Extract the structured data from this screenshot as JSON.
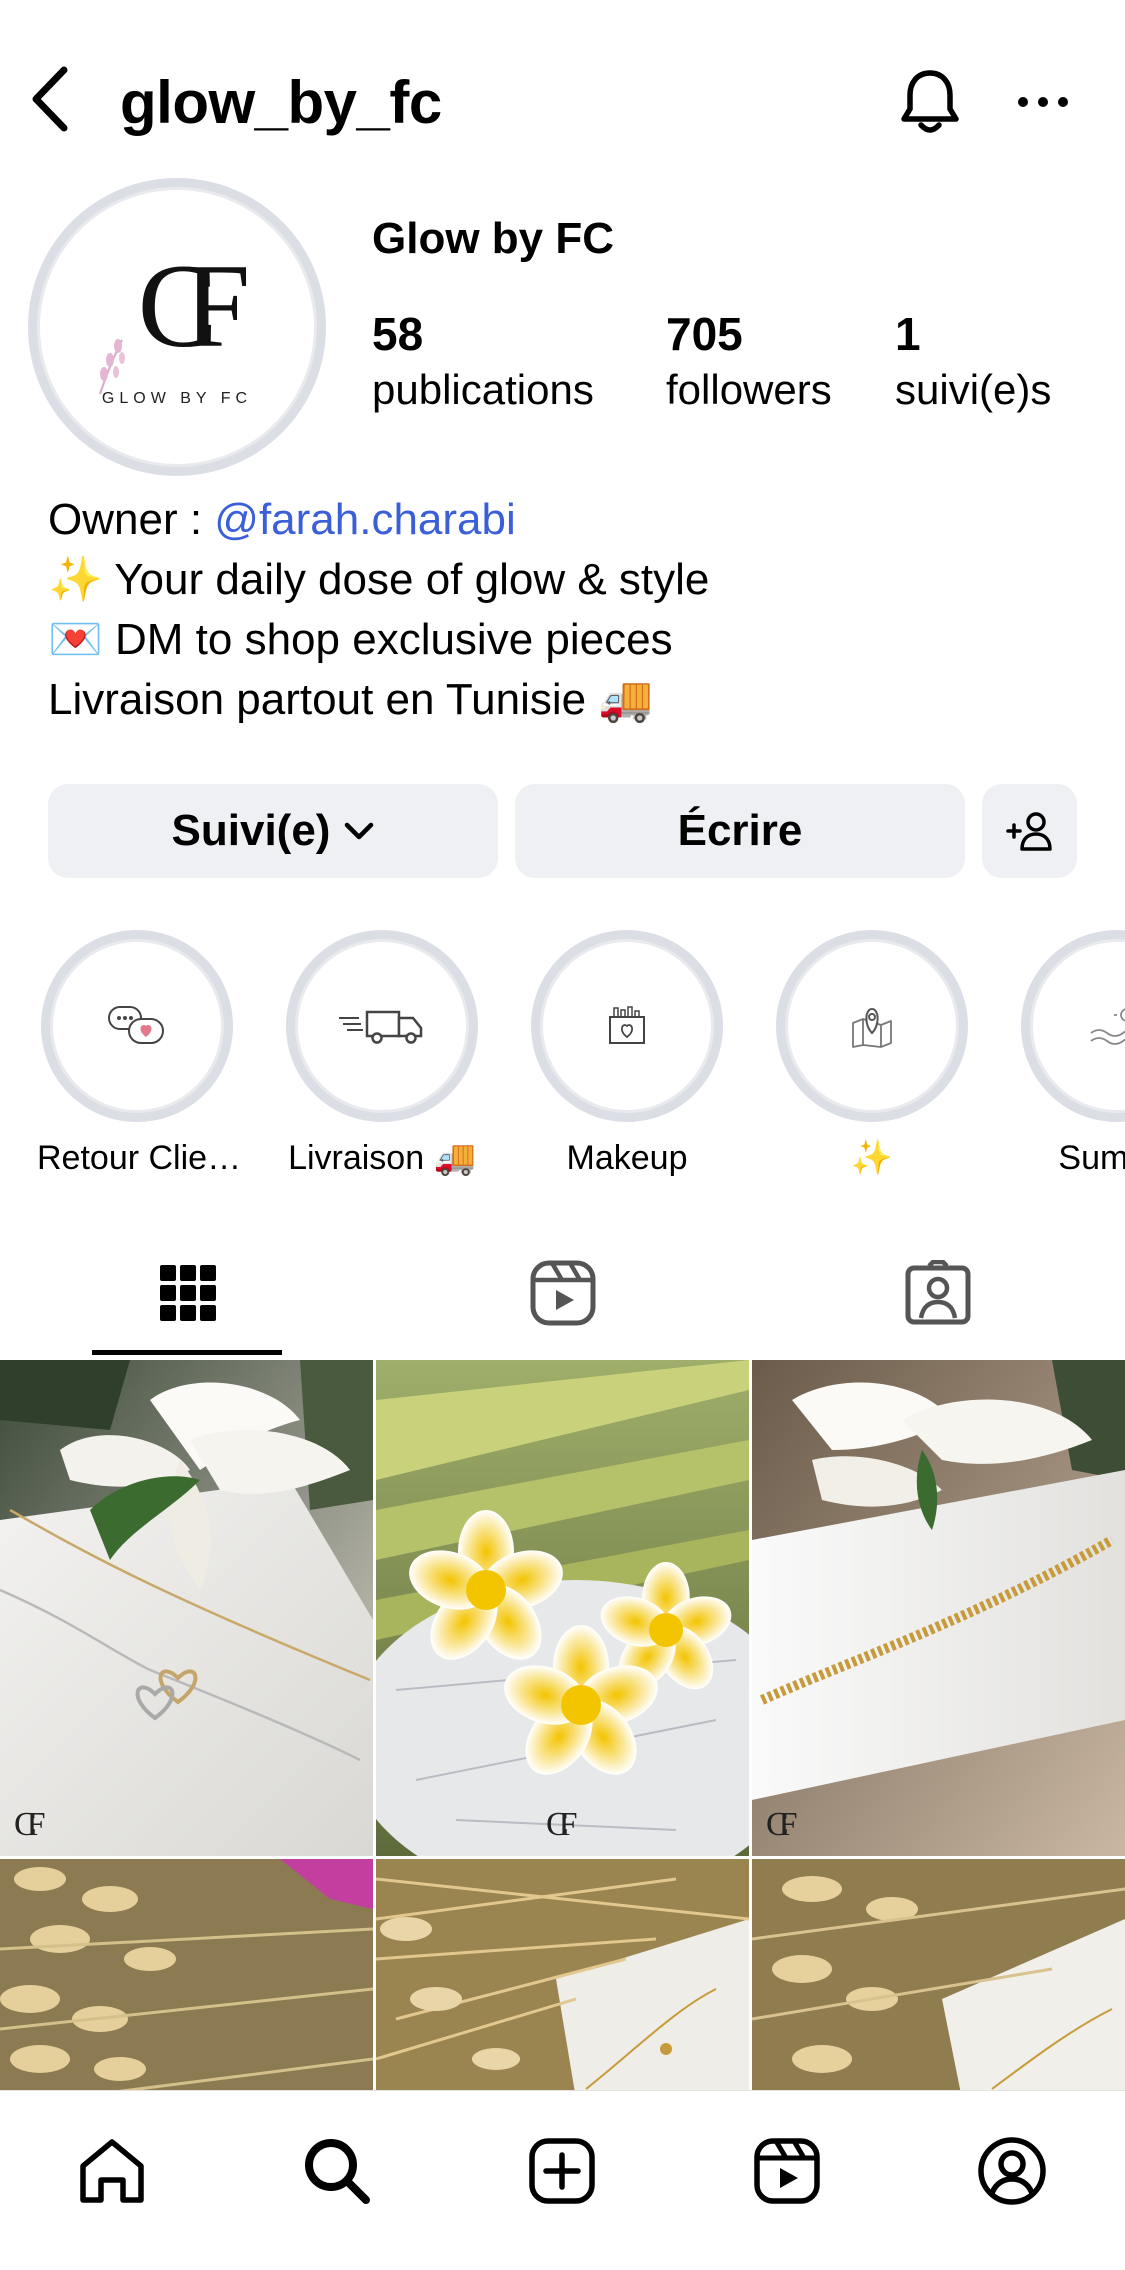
{
  "header": {
    "username": "glow_by_fc"
  },
  "profile": {
    "avatar_monogram": "CF",
    "avatar_brand": "GLOW BY FC",
    "display_name": "Glow by FC",
    "stats": {
      "posts_count": "58",
      "posts_label": "publications",
      "followers_count": "705",
      "followers_label": "followers",
      "following_count": "1",
      "following_label": "suivi(e)s"
    },
    "bio": {
      "owner_prefix": "Owner : ",
      "owner_mention": "@farah.charabi",
      "line2": "✨ Your daily dose of glow & style",
      "line3": "💌 DM to shop exclusive pieces",
      "line4": "Livraison partout en Tunisie 🚚"
    }
  },
  "actions": {
    "follow_label": "Suivi(e)",
    "message_label": "Écrire"
  },
  "highlights": [
    {
      "label": "Retour Clie…",
      "icon": "chat-bubbles-heart-icon"
    },
    {
      "label": "Livraison 🚚",
      "icon": "delivery-truck-icon"
    },
    {
      "label": "Makeup",
      "icon": "makeup-box-icon"
    },
    {
      "label": "✨",
      "icon": "map-pin-icon"
    },
    {
      "label": "Summe",
      "icon": "sun-waves-icon"
    }
  ],
  "tabs": [
    {
      "name": "grid",
      "icon": "grid-icon",
      "active": true
    },
    {
      "name": "reels",
      "icon": "reels-icon",
      "active": false
    },
    {
      "name": "tagged",
      "icon": "tagged-person-icon",
      "active": false
    }
  ],
  "posts": [
    {
      "watermark": "CF",
      "subject": "heart bracelets"
    },
    {
      "watermark": "CF",
      "subject": "frangipani flowers"
    },
    {
      "watermark": "CF",
      "subject": "gold chain bracelet"
    },
    {
      "watermark": "",
      "subject": "dried bunny tail grass"
    },
    {
      "watermark": "",
      "subject": "dried grass with bracelet"
    },
    {
      "watermark": "",
      "subject": "dried grass with chain"
    }
  ],
  "nav": [
    {
      "name": "home",
      "icon": "home-icon"
    },
    {
      "name": "search",
      "icon": "search-icon"
    },
    {
      "name": "create",
      "icon": "create-plus-icon"
    },
    {
      "name": "reels",
      "icon": "reels-icon"
    },
    {
      "name": "profile",
      "icon": "profile-icon"
    }
  ],
  "colors": {
    "mention": "#3a5fd9",
    "button_bg": "#eff0f3",
    "ring": "#dcdee5"
  }
}
